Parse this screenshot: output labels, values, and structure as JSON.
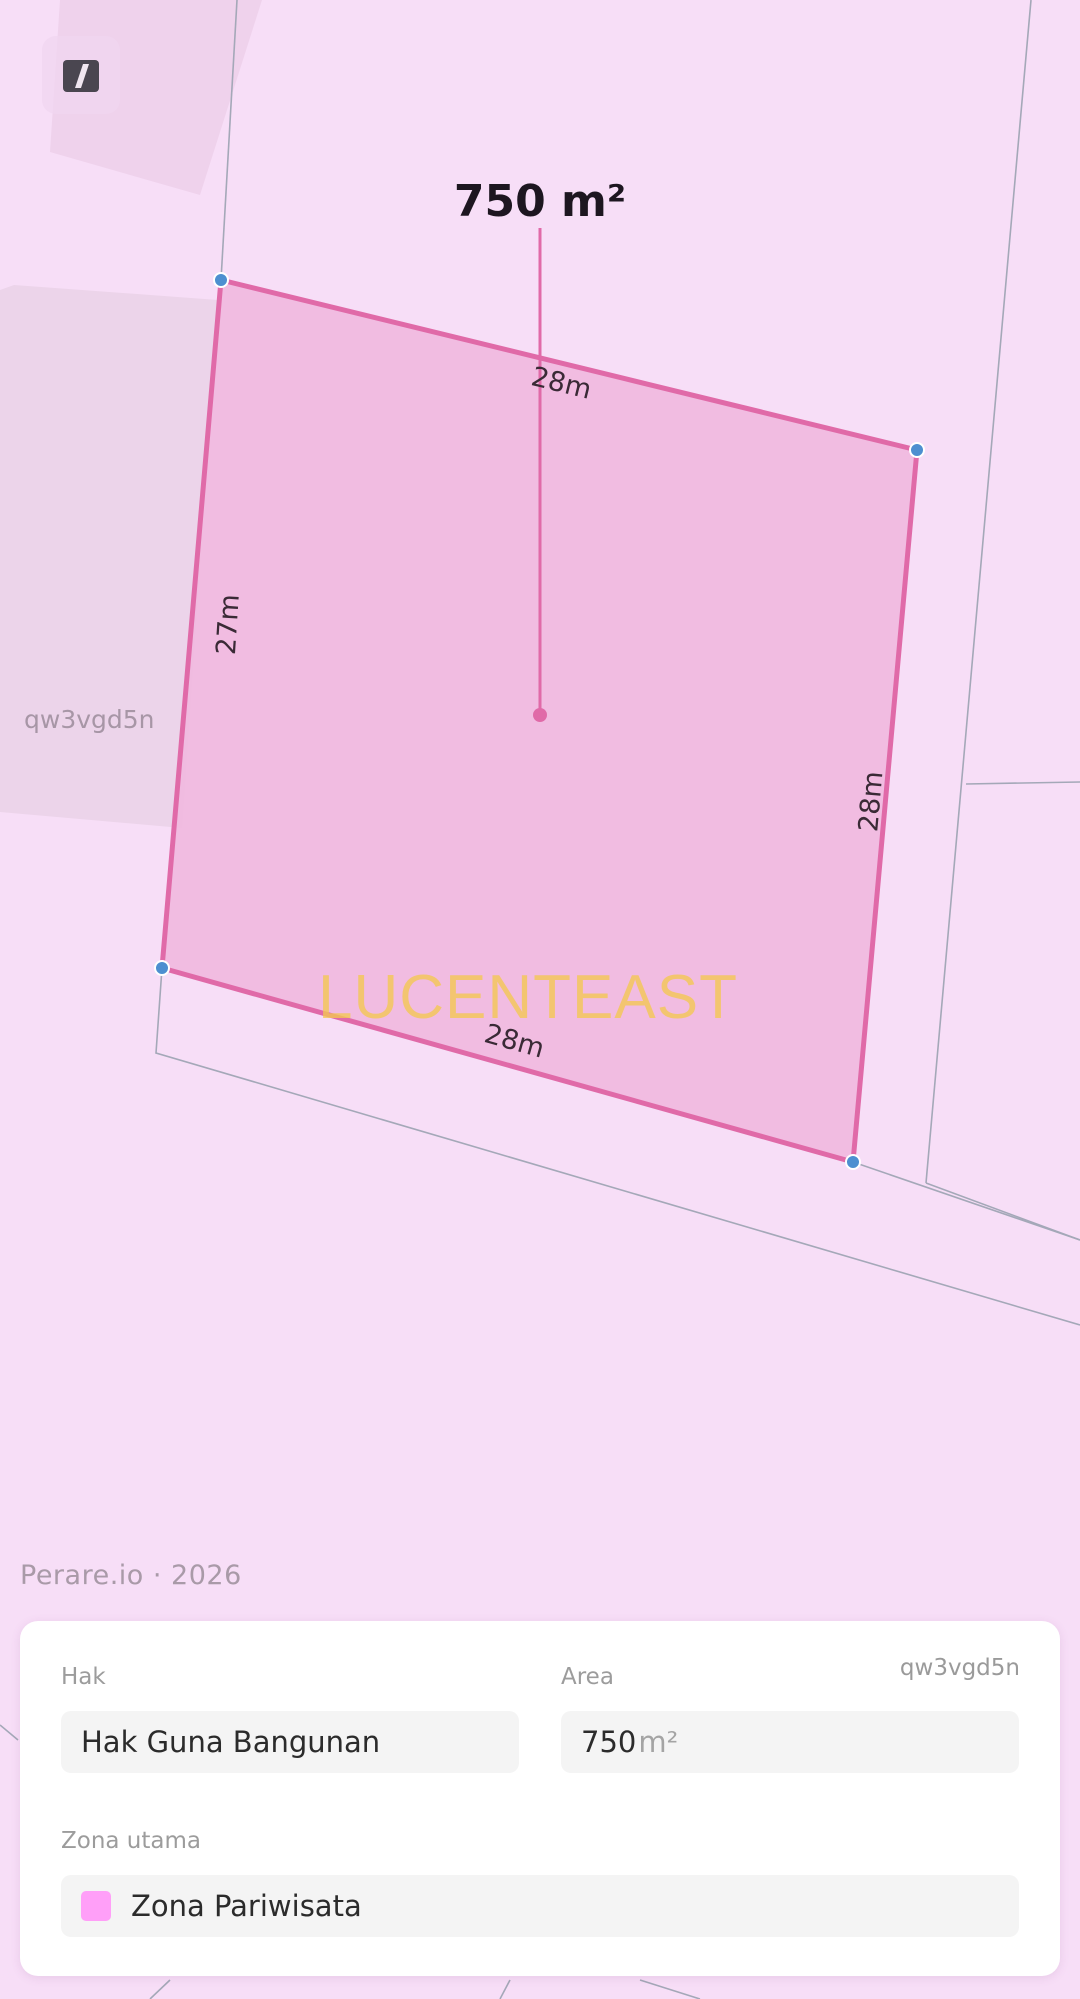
{
  "map": {
    "parcel_id_label": "qw3vgd5n",
    "area_label": "750 m²",
    "edge_lengths": [
      "28m",
      "28m",
      "28m",
      "27m"
    ],
    "watermark": "LUCENTEAST",
    "attribution": "Perare.io · 2026",
    "colors": {
      "background": "#f7def7",
      "parcel_fill": "#f0b8de",
      "parcel_stroke": "#e06aa8",
      "vertex": "#4d8fd0",
      "boundary_line": "#a4a8b8"
    },
    "tool_icon": "edit-icon"
  },
  "card": {
    "id": "qw3vgd5n",
    "hak_label": "Hak",
    "hak_value": "Hak Guna Bangunan",
    "area_label": "Area",
    "area_value": "750",
    "area_unit": "m²",
    "zona_label": "Zona utama",
    "zona_value": "Zona Pariwisata",
    "zona_color": "#ff9ff8"
  }
}
